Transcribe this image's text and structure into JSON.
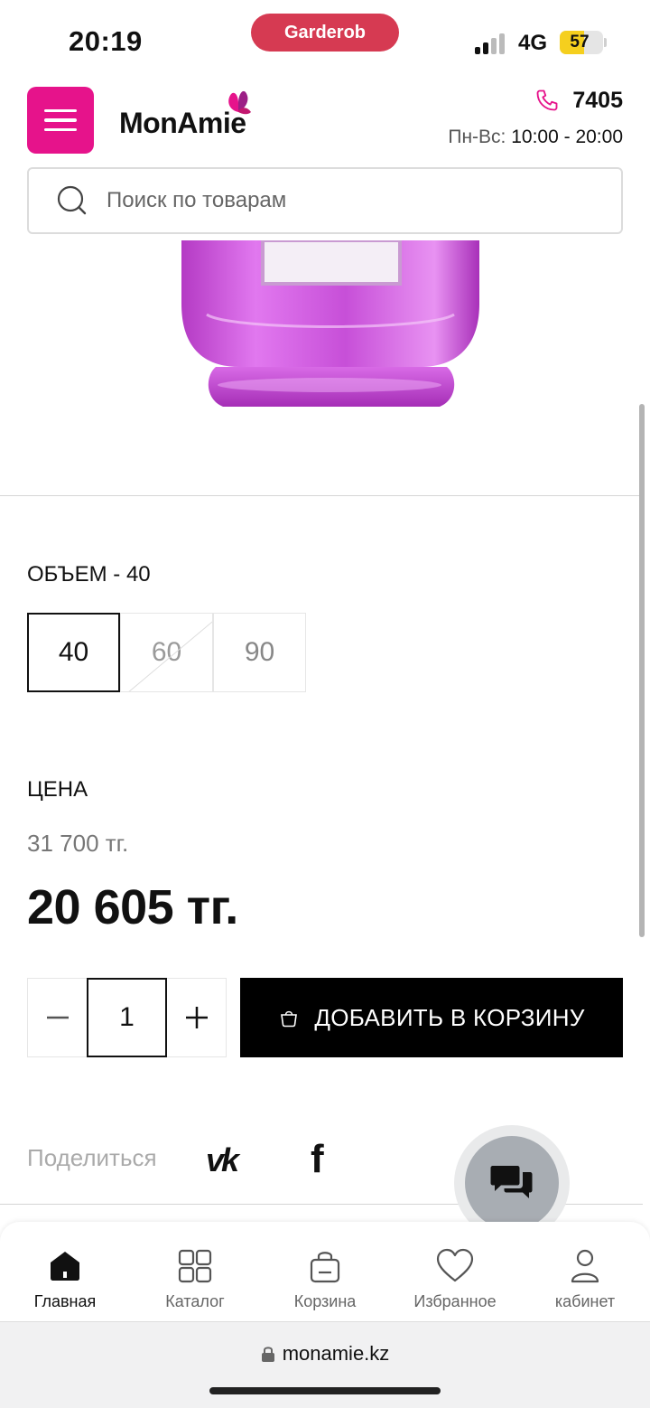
{
  "status_bar": {
    "time": "20:19",
    "app_pill": "Garderob",
    "network": "4G",
    "battery": "57",
    "battery_level": 0.57
  },
  "header": {
    "logo_text": "MonAmie",
    "phone": "7405",
    "hours_label": "Пн-Вс:",
    "hours_value": "10:00 - 20:00",
    "menu_icon": "hamburger-icon",
    "phone_icon": "phone-icon"
  },
  "search": {
    "placeholder": "Поиск по товарам",
    "icon": "search-icon"
  },
  "product": {
    "volume_label": "ОБЪЕМ - 40",
    "volume_options": [
      {
        "label": "40",
        "state": "selected"
      },
      {
        "label": "60",
        "state": "disabled"
      },
      {
        "label": "90",
        "state": "available"
      }
    ],
    "price_label": "ЦЕНА",
    "old_price": "31 700 тг.",
    "new_price": "20 605 тг.",
    "quantity": "1",
    "add_to_cart_label": "ДОБАВИТЬ В КОРЗИНУ"
  },
  "share": {
    "label": "Поделиться",
    "vk": "vk",
    "fb": "f"
  },
  "bottom_nav": {
    "items": [
      {
        "label": "Главная",
        "icon": "home-icon",
        "active": true
      },
      {
        "label": "Каталог",
        "icon": "grid-icon",
        "active": false
      },
      {
        "label": "Корзина",
        "icon": "bag-icon",
        "active": false
      },
      {
        "label": "Избранное",
        "icon": "heart-icon",
        "active": false
      },
      {
        "label": "кабинет",
        "icon": "user-icon",
        "active": false
      }
    ]
  },
  "browser": {
    "url": "monamie.kz"
  },
  "colors": {
    "brand_pink": "#e6138b",
    "pill_red": "#d63a52",
    "cart_button": "#000000"
  }
}
